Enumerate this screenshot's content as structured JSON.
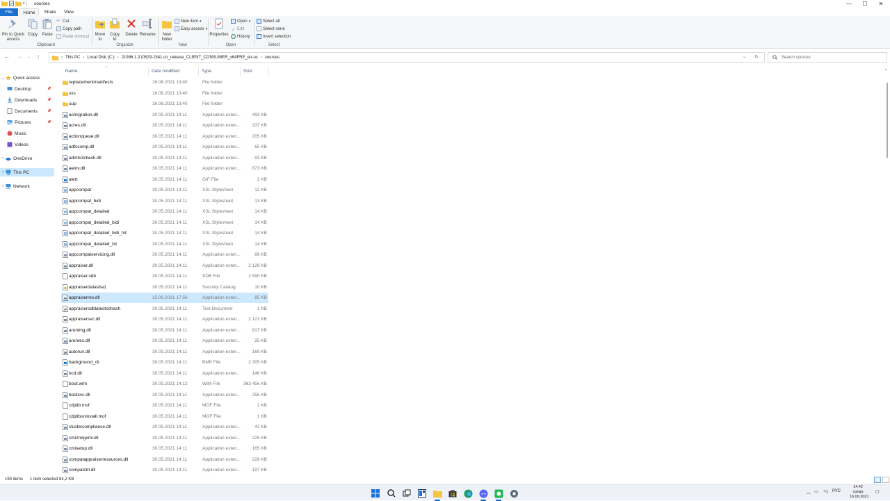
{
  "window": {
    "title": "sources",
    "controls": {
      "minimize": "—",
      "maximize": "☐",
      "close": "✕"
    }
  },
  "menu": {
    "file": "File",
    "home": "Home",
    "share": "Share",
    "view": "View"
  },
  "ribbon": {
    "clipboard": {
      "pin": "Pin to Quick access",
      "copy": "Copy",
      "paste": "Paste",
      "cut": "Cut",
      "copy_path": "Copy path",
      "paste_shortcut": "Paste shortcut",
      "label": "Clipboard"
    },
    "organize": {
      "move_to": "Move to",
      "copy_to": "Copy to",
      "delete": "Delete",
      "rename": "Rename",
      "label": "Organize"
    },
    "new": {
      "new_folder": "New folder",
      "new_item": "New item",
      "easy_access": "Easy access",
      "label": "New"
    },
    "open": {
      "properties": "Properties",
      "open": "Open",
      "edit": "Edit",
      "history": "History",
      "label": "Open"
    },
    "select": {
      "select_all": "Select all",
      "select_none": "Select none",
      "invert": "Invert selection",
      "label": "Select"
    }
  },
  "address": {
    "crumbs": [
      "This PC",
      "Local Disk (C:)",
      "21996.1.210529-1541.co_release_CLIENT_CONSUMER_x64FRE_en-us",
      "sources"
    ],
    "search_placeholder": "Search sources"
  },
  "nav": {
    "quick_access": "Quick access",
    "desktop": "Desktop",
    "downloads": "Downloads",
    "documents": "Documents",
    "pictures": "Pictures",
    "music": "Music",
    "videos": "Videos",
    "onedrive": "OneDrive",
    "this_pc": "This PC",
    "network": "Network"
  },
  "columns": {
    "name": "Name",
    "date": "Date modified",
    "type": "Type",
    "size": "Size"
  },
  "files": [
    {
      "name": "replacementmanifests",
      "date": "16.06.2021 13:40",
      "type": "File folder",
      "size": "",
      "kind": "folder"
    },
    {
      "name": "sxs",
      "date": "16.06.2021 13:40",
      "type": "File folder",
      "size": "",
      "kind": "folder"
    },
    {
      "name": "uup",
      "date": "16.06.2021 13:40",
      "type": "File folder",
      "size": "",
      "kind": "folder"
    },
    {
      "name": "acmigration.dll",
      "date": "30.05.2021 14:11",
      "type": "Application exten...",
      "size": "493 KB",
      "kind": "dll"
    },
    {
      "name": "acres.dll",
      "date": "30.05.2021 14:11",
      "type": "Application exten...",
      "size": "337 KB",
      "kind": "dll"
    },
    {
      "name": "actionqueue.dll",
      "date": "30.05.2021 14:11",
      "type": "Application exten...",
      "size": "205 KB",
      "kind": "dll"
    },
    {
      "name": "adfscomp.dll",
      "date": "30.05.2021 14:11",
      "type": "Application exten...",
      "size": "65 KB",
      "kind": "dll"
    },
    {
      "name": "admtv3check.dll",
      "date": "30.05.2021 14:11",
      "type": "Application exten...",
      "size": "93 KB",
      "kind": "dll"
    },
    {
      "name": "aeinv.dll",
      "date": "30.05.2021 14:11",
      "type": "Application exten...",
      "size": "873 KB",
      "kind": "dll"
    },
    {
      "name": "alert",
      "date": "30.05.2021 14:11",
      "type": "GIF File",
      "size": "2 KB",
      "kind": "img"
    },
    {
      "name": "appcompat",
      "date": "30.05.2021 14:11",
      "type": "XSL Stylesheet",
      "size": "12 KB",
      "kind": "xsl"
    },
    {
      "name": "appcompat_bidi",
      "date": "30.05.2021 14:11",
      "type": "XSL Stylesheet",
      "size": "13 KB",
      "kind": "xsl"
    },
    {
      "name": "appcompat_detailed",
      "date": "30.05.2021 14:11",
      "type": "XSL Stylesheet",
      "size": "14 KB",
      "kind": "xsl"
    },
    {
      "name": "appcompat_detailed_bidi",
      "date": "30.05.2021 14:11",
      "type": "XSL Stylesheet",
      "size": "14 KB",
      "kind": "xsl"
    },
    {
      "name": "appcompat_detailed_bidi_txt",
      "date": "30.05.2021 14:11",
      "type": "XSL Stylesheet",
      "size": "14 KB",
      "kind": "xsl"
    },
    {
      "name": "appcompat_detailed_txt",
      "date": "30.05.2021 14:11",
      "type": "XSL Stylesheet",
      "size": "14 KB",
      "kind": "xsl"
    },
    {
      "name": "appcompatservicing.dll",
      "date": "30.05.2021 14:11",
      "type": "Application exten...",
      "size": "89 KB",
      "kind": "dll"
    },
    {
      "name": "appraiser.dll",
      "date": "30.05.2021 14:11",
      "type": "Application exten...",
      "size": "2 129 KB",
      "kind": "dll"
    },
    {
      "name": "appraiser.sdb",
      "date": "30.05.2021 14:11",
      "type": "SDB File",
      "size": "2 590 KB",
      "kind": "file"
    },
    {
      "name": "appraiserdatasha1",
      "date": "30.05.2021 14:11",
      "type": "Security Catalog",
      "size": "10 KB",
      "kind": "cat"
    },
    {
      "name": "appraiserres.dll",
      "date": "15.06.2021 17:56",
      "type": "Application exten...",
      "size": "85 KB",
      "kind": "dll",
      "selected": true
    },
    {
      "name": "appraisersdblatestoshash",
      "date": "30.05.2021 14:11",
      "type": "Text Document",
      "size": "1 KB",
      "kind": "txt"
    },
    {
      "name": "appraisersvc.dll",
      "date": "30.05.2021 14:11",
      "type": "Application exten...",
      "size": "2 121 KB",
      "kind": "dll"
    },
    {
      "name": "arunimg.dll",
      "date": "30.05.2021 14:11",
      "type": "Application exten...",
      "size": "817 KB",
      "kind": "dll"
    },
    {
      "name": "arunres.dll",
      "date": "30.05.2021 14:11",
      "type": "Application exten...",
      "size": "25 KB",
      "kind": "dll"
    },
    {
      "name": "autorun.dll",
      "date": "30.05.2021 14:11",
      "type": "Application exten...",
      "size": "169 KB",
      "kind": "dll"
    },
    {
      "name": "background_cli",
      "date": "30.05.2021 14:11",
      "type": "BMP File",
      "size": "2 305 KB",
      "kind": "img"
    },
    {
      "name": "bcd.dll",
      "date": "30.05.2021 14:11",
      "type": "Application exten...",
      "size": "146 KB",
      "kind": "dll"
    },
    {
      "name": "boot.wim",
      "date": "30.05.2021 14:12",
      "type": "WIM File",
      "size": "363 456 KB",
      "kind": "file"
    },
    {
      "name": "bootsvc.dll",
      "date": "30.05.2021 14:11",
      "type": "Application exten...",
      "size": "255 KB",
      "kind": "dll"
    },
    {
      "name": "cdplib.mof",
      "date": "30.05.2021 14:11",
      "type": "MOF File",
      "size": "2 KB",
      "kind": "file"
    },
    {
      "name": "cdplibuninstall.mof",
      "date": "30.05.2021 14:11",
      "type": "MOF File",
      "size": "1 KB",
      "kind": "file"
    },
    {
      "name": "clustercompliance.dll",
      "date": "30.05.2021 14:11",
      "type": "Application exten...",
      "size": "41 KB",
      "kind": "dll"
    },
    {
      "name": "cmi2migxml.dll",
      "date": "30.05.2021 14:11",
      "type": "Application exten...",
      "size": "225 KB",
      "kind": "dll"
    },
    {
      "name": "cmisetup.dll",
      "date": "30.05.2021 14:11",
      "type": "Application exten...",
      "size": "165 KB",
      "kind": "dll"
    },
    {
      "name": "compatappraiserresources.dll",
      "date": "30.05.2021 14:11",
      "type": "Application exten...",
      "size": "229 KB",
      "kind": "dll"
    },
    {
      "name": "compatctrl.dll",
      "date": "30.05.2021 14:11",
      "type": "Application exten...",
      "size": "197 KB",
      "kind": "dll"
    }
  ],
  "status": {
    "items": "193 items",
    "selected": "1 item selected  84,2 KB"
  },
  "taskbar": {
    "lang": "РУС",
    "time": "14:42",
    "day": "среда",
    "date": "16.06.2021"
  },
  "colors": {
    "accent": "#1a6fd1",
    "selection": "#cce8ff",
    "folder": "#f5c542"
  }
}
